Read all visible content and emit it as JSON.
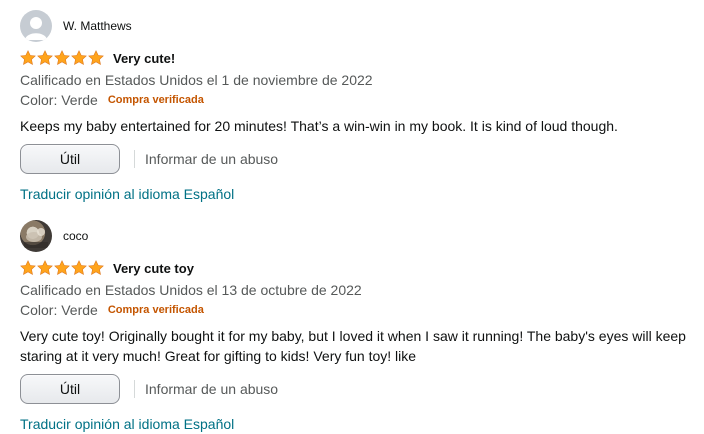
{
  "reviews": [
    {
      "reviewer": "W. Matthews",
      "rating": 5,
      "title": "Very cute!",
      "meta": "Calificado en Estados Unidos el 1 de noviembre de 2022",
      "color": "Color: Verde",
      "badge": "Compra verificada",
      "body": "Keeps my baby entertained for 20 minutes! That’s a win-win in my book. It is kind of loud though.",
      "helpful_label": "Útil",
      "report_label": "Informar de un abuso",
      "translate_label": "Traducir opinión al idioma Español"
    },
    {
      "reviewer": "coco",
      "rating": 5,
      "title": "Very cute toy",
      "meta": "Calificado en Estados Unidos el 13 de octubre de 2022",
      "color": "Color: Verde",
      "badge": "Compra verificada",
      "body": "Very cute toy! Originally bought it for my baby, but I loved it when I saw it running! The baby's eyes will keep staring at it very much! Great for gifting to kids! Very fun toy! like",
      "helpful_label": "Útil",
      "report_label": "Informar de un abuso",
      "translate_label": "Traducir opinión al idioma Español"
    }
  ],
  "colors": {
    "star": "#ffa41c",
    "link": "#007185",
    "badge": "#c45500",
    "muted": "#565959"
  },
  "icons": {
    "default_avatar": "person-silhouette-icon",
    "photo_avatar": "profile-photo",
    "star": "star-filled-icon"
  }
}
